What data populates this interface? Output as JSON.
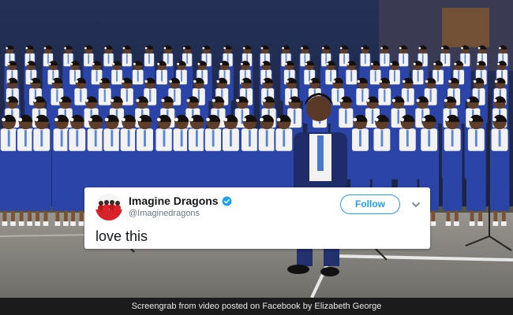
{
  "tweet": {
    "display_name": "Imagine Dragons",
    "handle": "@Imaginedragons",
    "follow_label": "Follow",
    "text": "love this",
    "verified": true
  },
  "caption": "Screengrab from video posted on Facebook by Elizabeth George",
  "icons": {
    "verified": "verified-badge-icon",
    "menu": "chevron-down-icon"
  },
  "colors": {
    "twitter_blue": "#1da1f2",
    "uniform_blue": "#2b44a8",
    "blouse_white": "#f2f2f2",
    "caption_bg": "#1b1b1b"
  }
}
